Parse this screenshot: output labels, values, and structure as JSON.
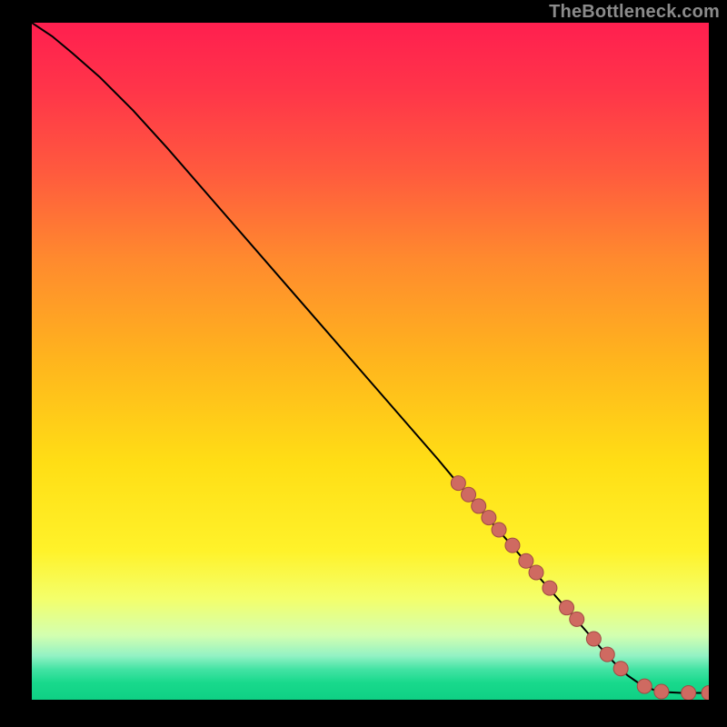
{
  "watermark": "TheBottleneck.com",
  "colors": {
    "background_black": "#000000",
    "gradient_stops": [
      {
        "offset": 0.0,
        "color": "#ff1f4f"
      },
      {
        "offset": 0.1,
        "color": "#ff3549"
      },
      {
        "offset": 0.22,
        "color": "#ff5a3e"
      },
      {
        "offset": 0.35,
        "color": "#ff8a2e"
      },
      {
        "offset": 0.5,
        "color": "#ffb51d"
      },
      {
        "offset": 0.65,
        "color": "#ffde15"
      },
      {
        "offset": 0.78,
        "color": "#fff22a"
      },
      {
        "offset": 0.85,
        "color": "#f4ff6a"
      },
      {
        "offset": 0.905,
        "color": "#d3ffb0"
      },
      {
        "offset": 0.935,
        "color": "#93f2c4"
      },
      {
        "offset": 0.955,
        "color": "#43e3a4"
      },
      {
        "offset": 0.975,
        "color": "#18d98c"
      },
      {
        "offset": 1.0,
        "color": "#0fd084"
      }
    ],
    "curve": "#000000",
    "marker_fill": "#cf6a61",
    "marker_stroke": "#a14b44"
  },
  "chart_data": {
    "type": "line",
    "title": "",
    "xlabel": "",
    "ylabel": "",
    "xlim": [
      0,
      100
    ],
    "ylim": [
      0,
      100
    ],
    "series": [
      {
        "name": "curve",
        "x": [
          0,
          3,
          6,
          10,
          15,
          20,
          30,
          40,
          50,
          60,
          65,
          70,
          75,
          80,
          84,
          86,
          88,
          90,
          92,
          94,
          96,
          98,
          100
        ],
        "y": [
          100,
          98,
          95.5,
          92,
          87,
          81.5,
          70,
          58.5,
          47,
          35.5,
          29.5,
          23.8,
          18,
          12.3,
          7.7,
          5.5,
          3.6,
          2.2,
          1.4,
          1.1,
          1.0,
          1.0,
          1.0
        ]
      }
    ],
    "markers": {
      "name": "highlighted-points",
      "x": [
        63,
        64.5,
        66,
        67.5,
        69,
        71,
        73,
        74.5,
        76.5,
        79,
        80.5,
        83,
        85,
        87,
        90.5,
        93,
        97,
        100
      ],
      "y": [
        32,
        30.3,
        28.6,
        26.9,
        25.1,
        22.8,
        20.5,
        18.8,
        16.5,
        13.6,
        11.9,
        9.0,
        6.7,
        4.6,
        2.0,
        1.2,
        1.0,
        1.0
      ]
    }
  }
}
